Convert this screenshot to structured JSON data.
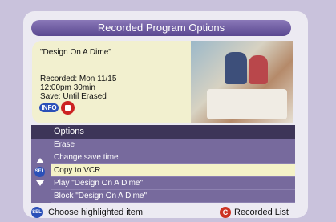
{
  "header": {
    "title": "Recorded Program Options"
  },
  "program": {
    "name": "\"Design On A Dime\"",
    "recorded": "Recorded: Mon 11/15",
    "time": "12:00pm  30min",
    "save": "Save: Until Erased",
    "info_label": "INFO",
    "lock_icon": "lock-icon"
  },
  "options": {
    "header": "Options",
    "items": [
      {
        "label": "Erase",
        "selected": false
      },
      {
        "label": "Change save time",
        "selected": false
      },
      {
        "label": "Copy to VCR",
        "selected": true
      },
      {
        "label": "Play \"Design On A Dime\"",
        "selected": false
      },
      {
        "label": "Block \"Design On A Dime\"",
        "selected": false
      }
    ],
    "sel_label": "SEL"
  },
  "footer": {
    "sel_label": "SEL",
    "left_text": "Choose highlighted item",
    "c_label": "C",
    "right_text": "Recorded List"
  },
  "colors": {
    "title_bar": "#5a4890",
    "info_panel": "#f2f0cf",
    "options_bg": "#776a9d",
    "selected_bg": "#f5f2c8",
    "footer_red": "#cc3322"
  }
}
